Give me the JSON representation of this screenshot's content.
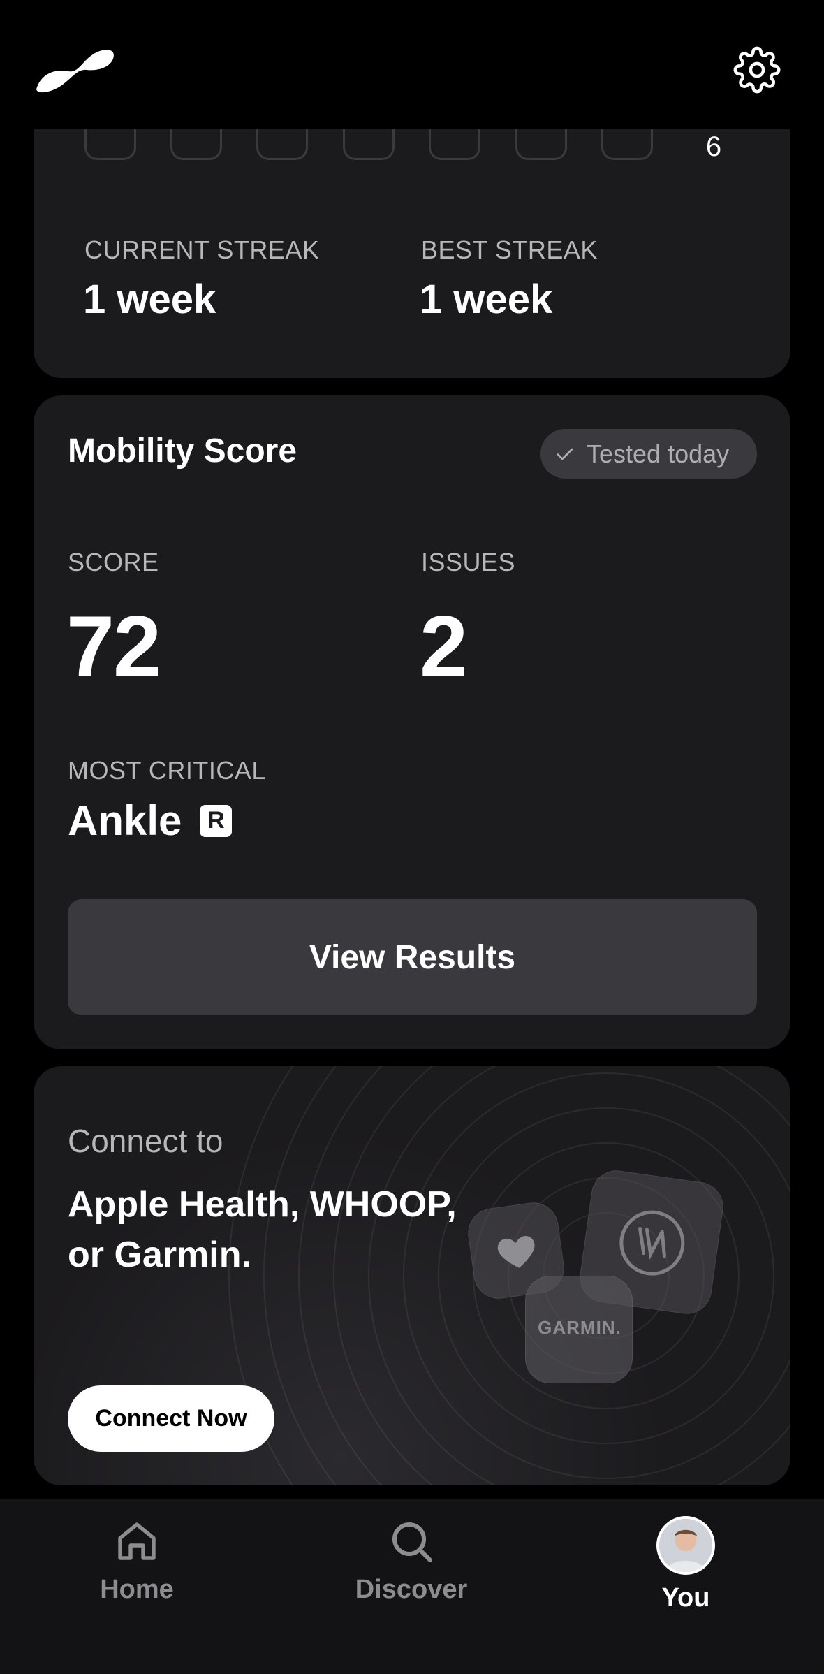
{
  "header": {
    "logo_icon": "brand-logo-icon",
    "settings_icon": "gear-icon"
  },
  "streak": {
    "day_count": "6",
    "current_label": "CURRENT STREAK",
    "current_value": "1 week",
    "best_label": "BEST STREAK",
    "best_value": "1 week"
  },
  "mobility": {
    "title": "Mobility Score",
    "badge": "Tested today",
    "score_label": "SCORE",
    "score_value": "72",
    "issues_label": "ISSUES",
    "issues_value": "2",
    "critical_label": "MOST CRITICAL",
    "critical_value": "Ankle",
    "critical_side": "R",
    "button": "View Results"
  },
  "connect": {
    "subtitle": "Connect to",
    "title": "Apple Health, WHOOP, or Garmin.",
    "garmin_label": "GARMIN.",
    "whoop_label": "W",
    "button": "Connect Now"
  },
  "nav": {
    "items": [
      {
        "label": "Home",
        "icon": "home-icon",
        "active": false
      },
      {
        "label": "Discover",
        "icon": "search-icon",
        "active": false
      },
      {
        "label": "You",
        "icon": "avatar",
        "active": true
      }
    ]
  },
  "colors": {
    "background": "#000000",
    "card": "#1b1a1d",
    "muted_text": "#b7b6ba",
    "button_bg": "#3a393d"
  }
}
